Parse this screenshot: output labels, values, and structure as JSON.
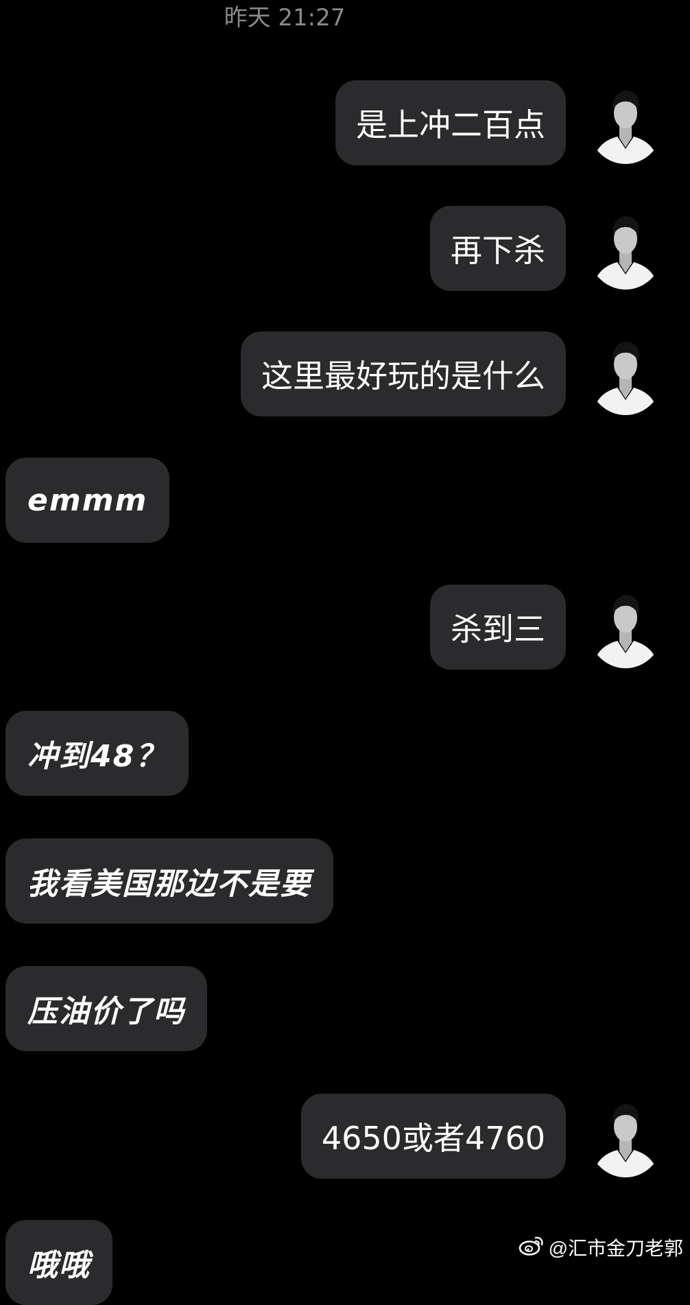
{
  "chat": {
    "timestamp": "昨天 21:27",
    "messages": [
      {
        "text": "是上冲二百点",
        "direction": "out"
      },
      {
        "text": "再下杀",
        "direction": "out"
      },
      {
        "text": "这里最好玩的是什么",
        "direction": "out"
      },
      {
        "text": "emmm",
        "direction": "in"
      },
      {
        "text": "杀到三",
        "direction": "out"
      },
      {
        "text": "冲到48？",
        "direction": "in"
      },
      {
        "text": "我看美国那边不是要",
        "direction": "in"
      },
      {
        "text": "压油价了吗",
        "direction": "in"
      },
      {
        "text": "4650或者4760",
        "direction": "out"
      },
      {
        "text": "哦哦",
        "direction": "in"
      }
    ]
  },
  "watermark": {
    "text": "@汇市金刀老郭",
    "icon": "weibo-icon"
  },
  "colors": {
    "background": "#000000",
    "bubble": "#2b2b2d",
    "timestamp": "#8a8a8a"
  }
}
